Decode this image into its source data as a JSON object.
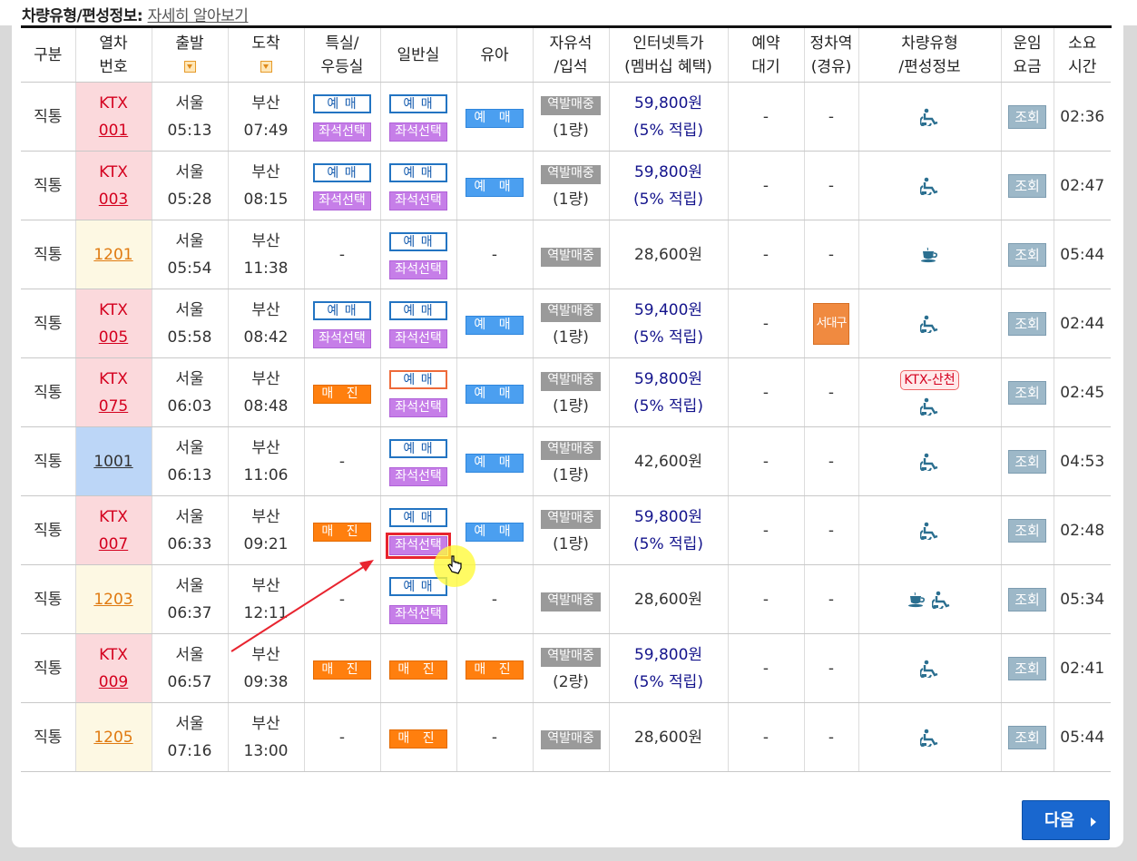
{
  "header": {
    "title": "차량유형/편성정보:",
    "link": "자세히 알아보기"
  },
  "columns": [
    {
      "l1": "구분",
      "l2": ""
    },
    {
      "l1": "열차",
      "l2": "번호"
    },
    {
      "l1": "출발",
      "l2": ""
    },
    {
      "l1": "도착",
      "l2": ""
    },
    {
      "l1": "특실/",
      "l2": "우등실"
    },
    {
      "l1": "일반실",
      "l2": ""
    },
    {
      "l1": "유아",
      "l2": ""
    },
    {
      "l1": "자유석",
      "l2": "/입석"
    },
    {
      "l1": "인터넷특가",
      "l2": "(멤버십 혜택)"
    },
    {
      "l1": "예약",
      "l2": "대기"
    },
    {
      "l1": "정차역",
      "l2": "(경유)"
    },
    {
      "l1": "차량유형",
      "l2": "/편성정보"
    },
    {
      "l1": "운임",
      "l2": "요금"
    },
    {
      "l1": "소요",
      "l2": "시간"
    }
  ],
  "labels": {
    "reserve": "예 매",
    "seat_select": "좌석선택",
    "sold_out": "매 진",
    "infant_reserve": "예 매",
    "station_sale": "역발매중",
    "query": "조회",
    "dash": "-",
    "next": "다음"
  },
  "rows": [
    {
      "type": "직통",
      "train_kind": "ktx",
      "train_l1": "KTX",
      "train_l2": "001",
      "dep_st": "서울",
      "dep_t": "05:13",
      "arr_st": "부산",
      "arr_t": "07:49",
      "special": "reserve_seat",
      "general": "reserve_seat",
      "infant": "reserve",
      "free": "(1량)",
      "price": "59,800원",
      "price_note": "(5% 적립)",
      "wait": "-",
      "stop": "-",
      "vehicle": "wheelchair",
      "duration": "02:36"
    },
    {
      "type": "직통",
      "train_kind": "ktx",
      "train_l1": "KTX",
      "train_l2": "003",
      "dep_st": "서울",
      "dep_t": "05:28",
      "arr_st": "부산",
      "arr_t": "08:15",
      "special": "reserve_seat",
      "general": "reserve_seat",
      "infant": "reserve",
      "free": "(1량)",
      "price": "59,800원",
      "price_note": "(5% 적립)",
      "wait": "-",
      "stop": "-",
      "vehicle": "wheelchair",
      "duration": "02:47"
    },
    {
      "type": "직통",
      "train_kind": "itx",
      "train_l1": "",
      "train_l2": "1201",
      "dep_st": "서울",
      "dep_t": "05:54",
      "arr_st": "부산",
      "arr_t": "11:38",
      "special": "none",
      "general": "reserve_seat",
      "infant": "none",
      "free": "",
      "price": "28,600원",
      "price_note": "",
      "wait": "-",
      "stop": "-",
      "vehicle": "cafe",
      "duration": "05:44"
    },
    {
      "type": "직통",
      "train_kind": "ktx",
      "train_l1": "KTX",
      "train_l2": "005",
      "dep_st": "서울",
      "dep_t": "05:58",
      "arr_st": "부산",
      "arr_t": "08:42",
      "special": "reserve_seat",
      "general": "reserve_seat",
      "infant": "reserve",
      "free": "(1량)",
      "price": "59,400원",
      "price_note": "(5% 적립)",
      "wait": "-",
      "stop": "서대구",
      "vehicle": "wheelchair",
      "duration": "02:44"
    },
    {
      "type": "직통",
      "train_kind": "ktx",
      "train_l1": "KTX",
      "train_l2": "075",
      "dep_st": "서울",
      "dep_t": "06:03",
      "arr_st": "부산",
      "arr_t": "08:48",
      "special": "sold",
      "general": "reserve_seat_o",
      "infant": "reserve",
      "free": "(1량)",
      "price": "59,800원",
      "price_note": "(5% 적립)",
      "wait": "-",
      "stop": "-",
      "vehicle": "ktx_sancheon",
      "vehicle_tag": "KTX-산천",
      "duration": "02:45"
    },
    {
      "type": "직통",
      "train_kind": "mug",
      "train_l1": "",
      "train_l2": "1001",
      "dep_st": "서울",
      "dep_t": "06:13",
      "arr_st": "부산",
      "arr_t": "11:06",
      "special": "none",
      "general": "reserve_seat",
      "infant": "reserve",
      "free": "(1량)",
      "price": "42,600원",
      "price_note": "",
      "wait": "-",
      "stop": "-",
      "vehicle": "wheelchair",
      "duration": "04:53"
    },
    {
      "type": "직통",
      "train_kind": "ktx",
      "train_l1": "KTX",
      "train_l2": "007",
      "dep_st": "서울",
      "dep_t": "06:33",
      "arr_st": "부산",
      "arr_t": "09:21",
      "special": "sold",
      "general": "reserve_seat_hi",
      "infant": "reserve",
      "free": "(1량)",
      "price": "59,800원",
      "price_note": "(5% 적립)",
      "wait": "-",
      "stop": "-",
      "vehicle": "wheelchair",
      "duration": "02:48"
    },
    {
      "type": "직통",
      "train_kind": "itx",
      "train_l1": "",
      "train_l2": "1203",
      "dep_st": "서울",
      "dep_t": "06:37",
      "arr_st": "부산",
      "arr_t": "12:11",
      "special": "none",
      "general": "reserve_seat",
      "infant": "none",
      "free": "",
      "price": "28,600원",
      "price_note": "",
      "wait": "-",
      "stop": "-",
      "vehicle": "cafe_wheelchair",
      "duration": "05:34"
    },
    {
      "type": "직통",
      "train_kind": "ktx",
      "train_l1": "KTX",
      "train_l2": "009",
      "dep_st": "서울",
      "dep_t": "06:57",
      "arr_st": "부산",
      "arr_t": "09:38",
      "special": "sold",
      "general": "sold",
      "infant": "sold",
      "free": "(2량)",
      "price": "59,800원",
      "price_note": "(5% 적립)",
      "wait": "-",
      "stop": "-",
      "vehicle": "wheelchair",
      "duration": "02:41"
    },
    {
      "type": "직통",
      "train_kind": "itx",
      "train_l1": "",
      "train_l2": "1205",
      "dep_st": "서울",
      "dep_t": "07:16",
      "arr_st": "부산",
      "arr_t": "13:00",
      "special": "none",
      "general": "sold",
      "infant": "none",
      "free": "",
      "price": "28,600원",
      "price_note": "",
      "wait": "-",
      "stop": "-",
      "vehicle": "wheelchair",
      "duration": "05:44"
    }
  ]
}
